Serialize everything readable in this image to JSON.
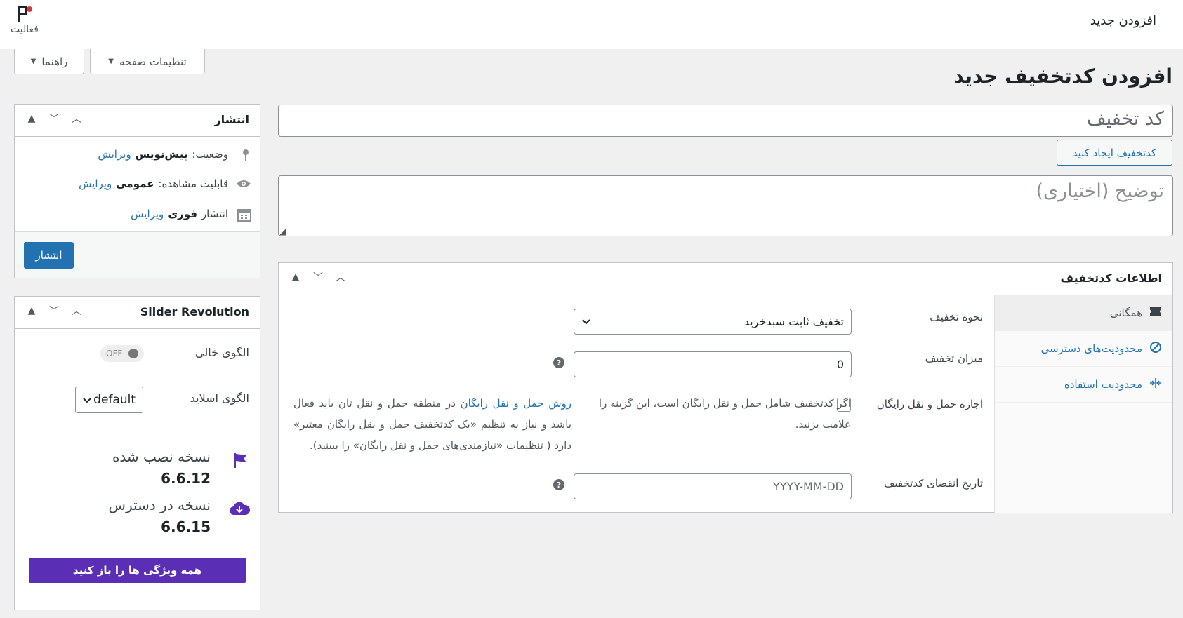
{
  "topbar": {
    "title": "افزودن جدید",
    "activity_label": "فعالیت"
  },
  "screen_buttons": {
    "page_settings": "تنظیمات صفحه",
    "help": "راهنما"
  },
  "page_title": "افزودن کدتخفیف جدید",
  "coupon_code": {
    "placeholder": "کد تخفیف"
  },
  "generate_button": "کدتخفیف ایجاد کنید",
  "description": {
    "placeholder": "توضیح (اختیاری)"
  },
  "coupon_data": {
    "title": "اطلاعات کدتخفیف",
    "tabs": [
      {
        "label": "همگانی",
        "icon": "ticket-icon"
      },
      {
        "label": "محدودیت‌های دسترسی",
        "icon": "ban-icon"
      },
      {
        "label": "محدودیت استفاده",
        "icon": "arrows-in-icon"
      }
    ],
    "discount_type": {
      "label": "نحوه تخفیف",
      "value": "تخفیف ثابت سبدخرید"
    },
    "amount": {
      "label": "میزان تخفیف",
      "value": "0"
    },
    "free_shipping": {
      "label": "اجازه حمل و نقل رایگان",
      "desc_before": "اگر کدتخفیف شامل حمل و نقل رایگان است، این گزینه را علامت بزنید.",
      "link": "روش حمل و نقل رایگان",
      "desc_after": "در منطقه حمل و نقل تان باید فعال باشد و نیاز به تنظیم «یک کدتخفیف حمل و نقل رایگان معتبر» دارد ( تنظیمات «نیازمندی‌های حمل و نقل رایگان» را ببینید)."
    },
    "expiry": {
      "label": "تاریخ انقضای کدتخفیف",
      "placeholder": "YYYY-MM-DD"
    },
    "help_glyph": "?"
  },
  "publish": {
    "title": "انتشار",
    "status_label": "وضعیت:",
    "status_value": "پیش‌نویس",
    "visibility_label": "قابلیت مشاهده:",
    "visibility_value": "عمومی",
    "publish_label": "انتشار",
    "publish_value": "فوری",
    "edit_link": "ویرایش",
    "publish_button": "انتشار"
  },
  "slider": {
    "title": "Slider Revolution",
    "blank_template_label": "الگوی خالی",
    "toggle_text": "OFF",
    "slide_template_label": "الگوی اسلاید",
    "slide_template_value": "default",
    "installed_label": "نسخه نصب شده",
    "installed_version": "6.6.12",
    "available_label": "نسخه در دسترس",
    "available_version": "6.6.15",
    "unlock_button": "همه ویژگی ها را باز کنید",
    "accent_color": "#5b2fb5"
  }
}
